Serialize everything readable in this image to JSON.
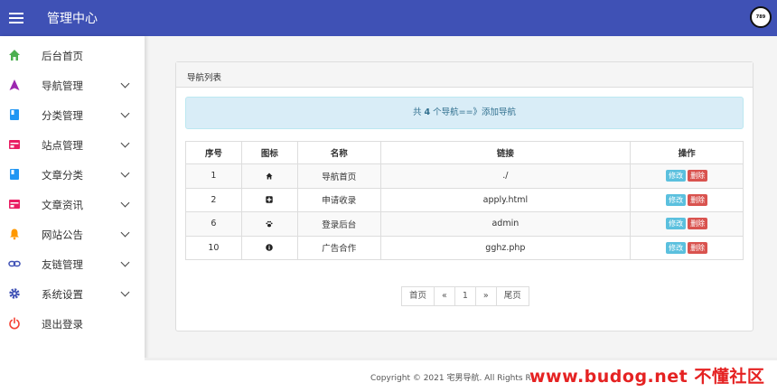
{
  "header": {
    "title": "管理中心",
    "avatar_text": "789",
    "accent": "#3f51b5"
  },
  "sidebar": {
    "items": [
      {
        "label": "后台首页",
        "icon": "home-icon",
        "color": "#4caf50",
        "expandable": false
      },
      {
        "label": "导航管理",
        "icon": "navigation-icon",
        "color": "#9c27b0",
        "expandable": true
      },
      {
        "label": "分类管理",
        "icon": "book-icon",
        "color": "#2196f3",
        "expandable": true
      },
      {
        "label": "站点管理",
        "icon": "web-icon",
        "color": "#e91e63",
        "expandable": true
      },
      {
        "label": "文章分类",
        "icon": "book-icon",
        "color": "#2196f3",
        "expandable": true
      },
      {
        "label": "文章资讯",
        "icon": "web-icon",
        "color": "#e91e63",
        "expandable": true
      },
      {
        "label": "网站公告",
        "icon": "bell-icon",
        "color": "#ff9800",
        "expandable": true
      },
      {
        "label": "友链管理",
        "icon": "link-icon",
        "color": "#3f51b5",
        "expandable": true
      },
      {
        "label": "系统设置",
        "icon": "gear-icon",
        "color": "#3f51b5",
        "expandable": true
      },
      {
        "label": "退出登录",
        "icon": "power-icon",
        "color": "#f44336",
        "expandable": false
      }
    ]
  },
  "panel": {
    "title": "导航列表",
    "info_prefix": "共 ",
    "info_count": "4",
    "info_suffix": " 个导航==》",
    "info_link": "添加导航"
  },
  "table": {
    "headers": [
      "序号",
      "图标",
      "名称",
      "链接",
      "操作"
    ],
    "rows": [
      {
        "id": "1",
        "icon": "home-icon",
        "name": "导航首页",
        "link": "./"
      },
      {
        "id": "2",
        "icon": "plus-square-icon",
        "name": "申请收录",
        "link": "apply.html"
      },
      {
        "id": "6",
        "icon": "paw-icon",
        "name": "登录后台",
        "link": "admin"
      },
      {
        "id": "10",
        "icon": "info-circle-icon",
        "name": "广告合作",
        "link": "gghz.php"
      }
    ],
    "edit_label": "修改",
    "delete_label": "删除"
  },
  "pagination": {
    "first": "首页",
    "prev": "«",
    "current": "1",
    "next": "»",
    "last": "尾页"
  },
  "footer": {
    "copyright": "Copyright © 2021 宅男导航. All Rights Re"
  },
  "watermark": "www.budog.net 不懂社区"
}
